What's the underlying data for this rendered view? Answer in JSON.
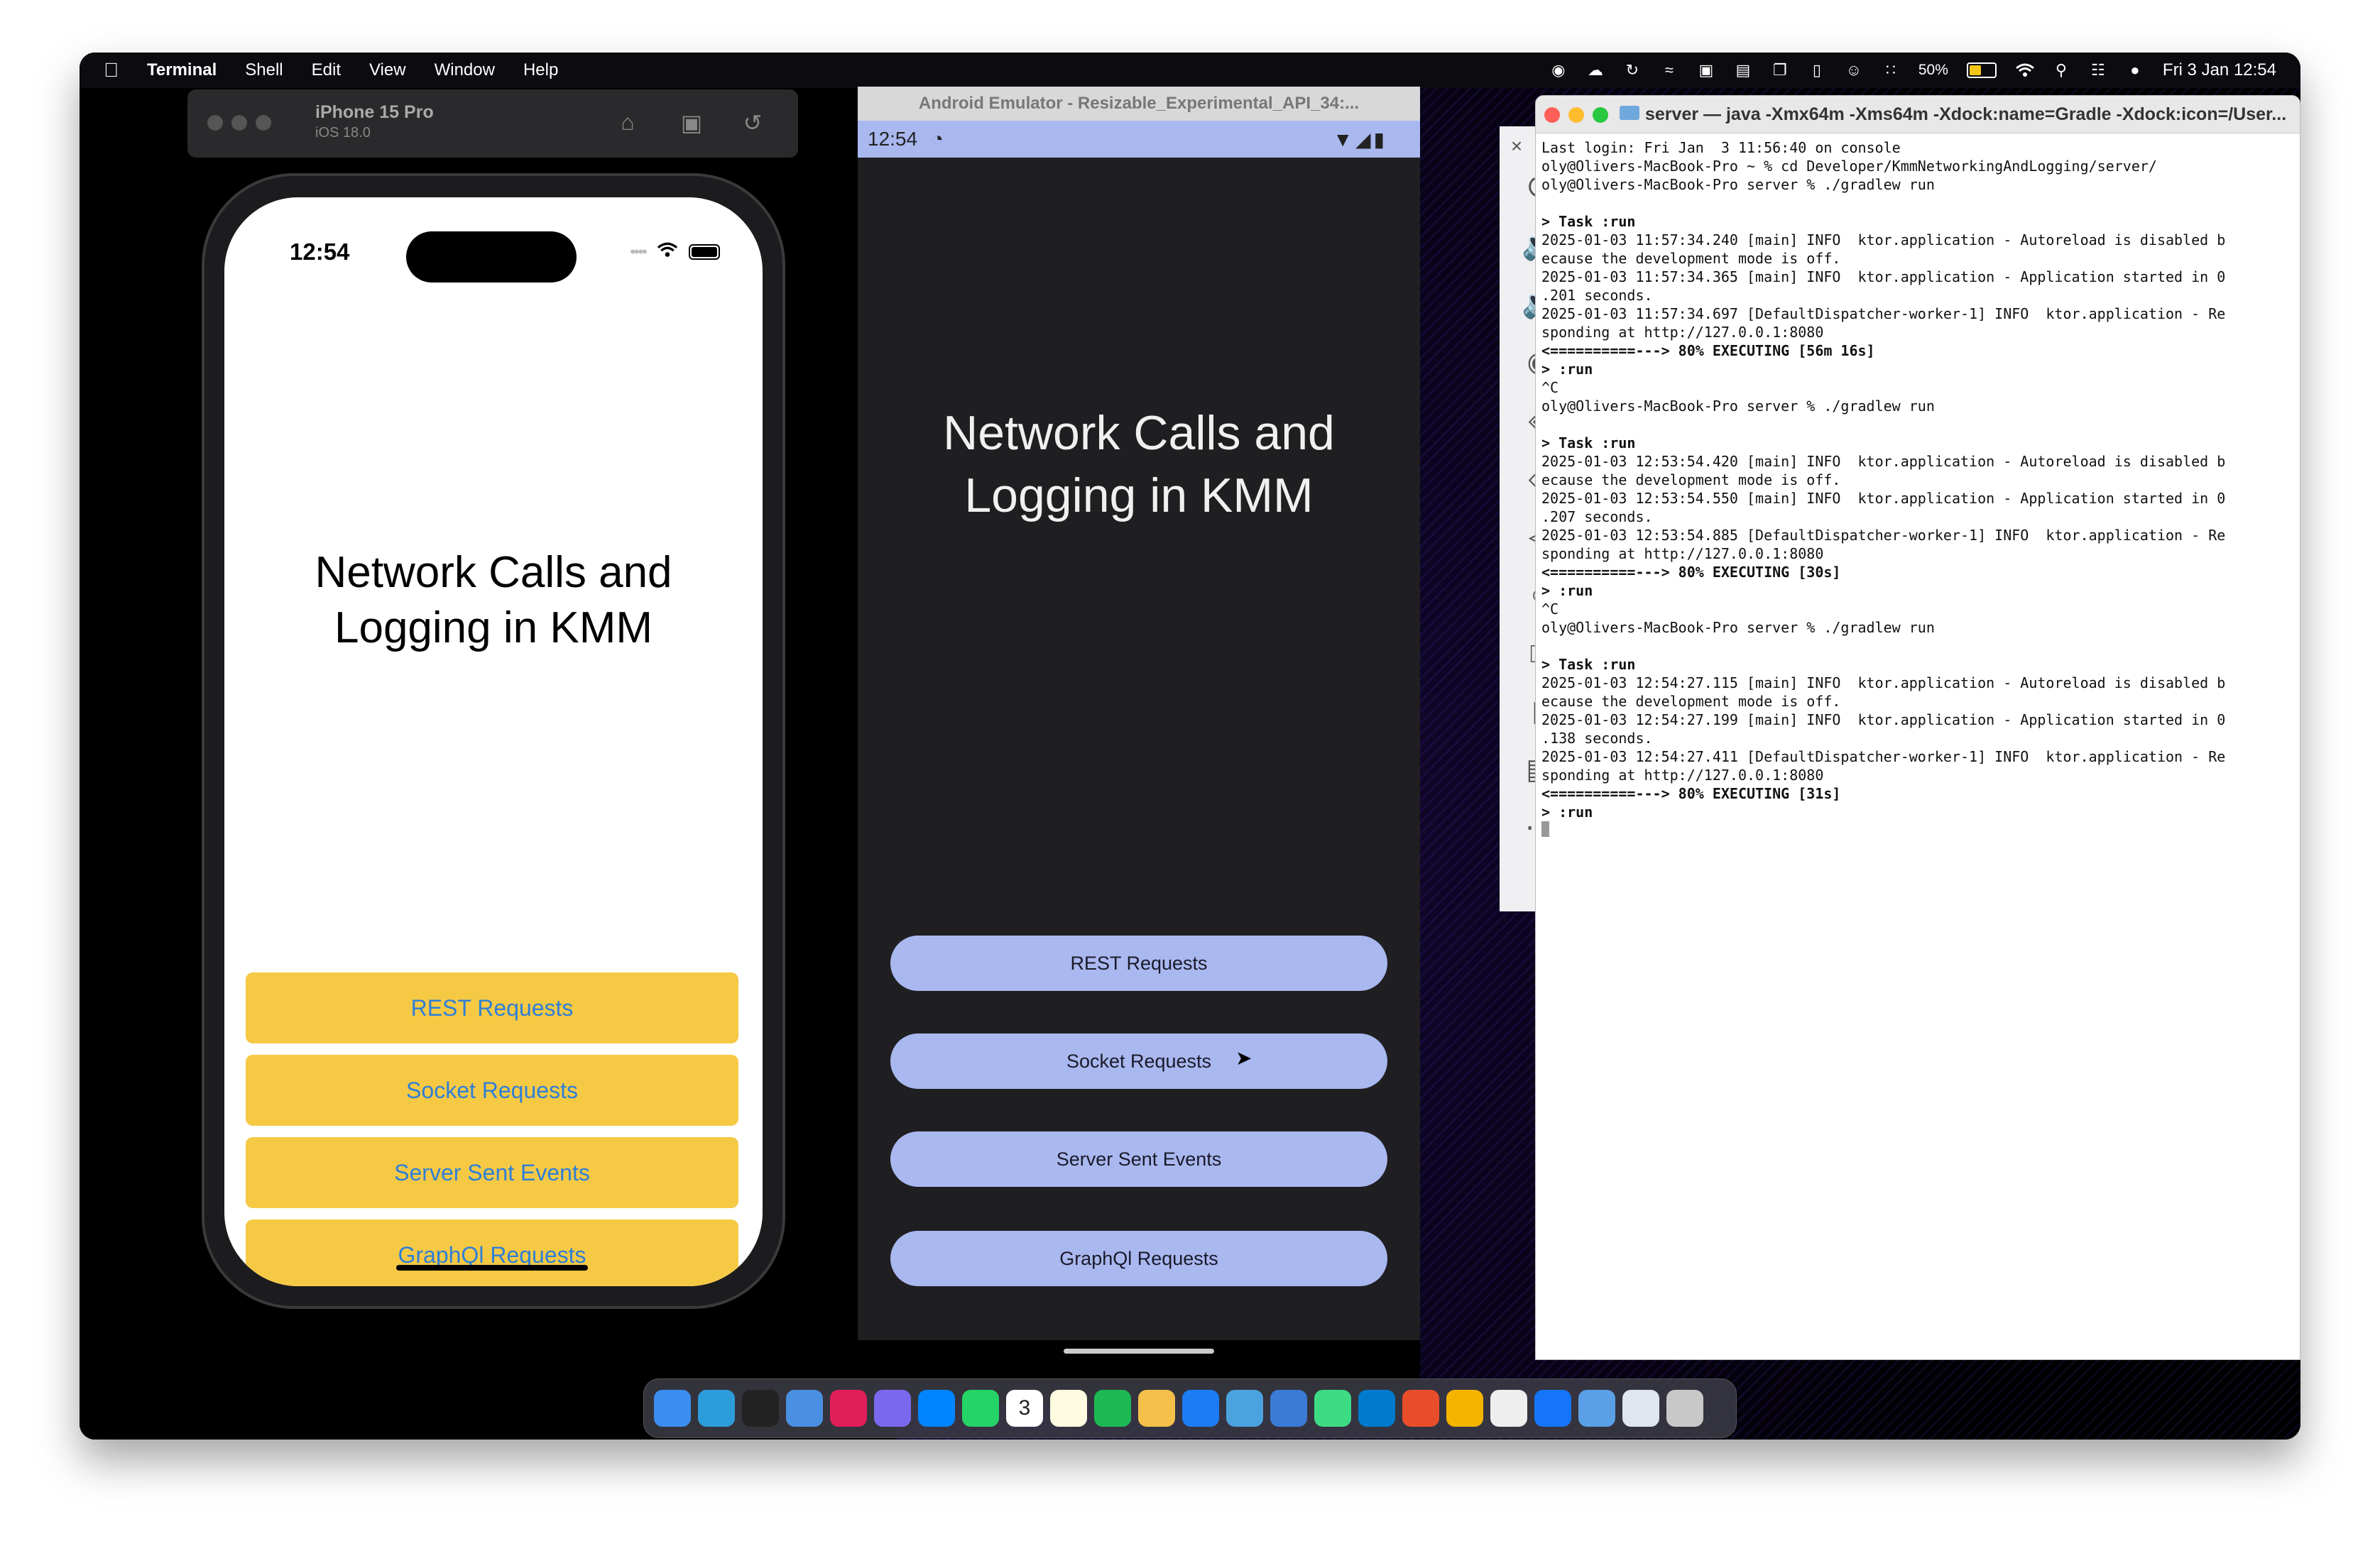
{
  "menubar": {
    "app_name": "Terminal",
    "items": [
      "Shell",
      "Edit",
      "View",
      "Window",
      "Help"
    ],
    "battery": "50%",
    "datetime": "Fri 3 Jan  12:54"
  },
  "simulator": {
    "device": "iPhone 15 Pro",
    "os": "iOS 18.0"
  },
  "iphone": {
    "time": "12:54",
    "title_line1": "Network Calls and",
    "title_line2": "Logging in KMM",
    "buttons": [
      "REST Requests",
      "Socket Requests",
      "Server Sent Events",
      "GraphQl Requests"
    ],
    "button_color": "#f6c945",
    "button_text_color": "#2e7fd6"
  },
  "android": {
    "window_title": "Android Emulator - Resizable_Experimental_API_34:...",
    "time": "12:54",
    "title_line1": "Network Calls and",
    "title_line2": "Logging in KMM",
    "buttons": [
      "REST Requests",
      "Socket Requests",
      "Server Sent Events",
      "GraphQl Requests"
    ],
    "button_color": "#aab8f0"
  },
  "terminal": {
    "title": "server — java -Xmx64m -Xms64m -Xdock:name=Gradle -Xdock:icon=/User...",
    "lines": [
      "Last login: Fri Jan  3 11:56:40 on console",
      "oly@Olivers-MacBook-Pro ~ % cd Developer/KmmNetworkingAndLogging/server/",
      "oly@Olivers-MacBook-Pro server % ./gradlew run",
      "",
      "> Task :run",
      "2025-01-03 11:57:34.240 [main] INFO  ktor.application - Autoreload is disabled b",
      "ecause the development mode is off.",
      "2025-01-03 11:57:34.365 [main] INFO  ktor.application - Application started in 0",
      ".201 seconds.",
      "2025-01-03 11:57:34.697 [DefaultDispatcher-worker-1] INFO  ktor.application - Re",
      "sponding at http://127.0.0.1:8080",
      "<==========---> 80% EXECUTING [56m 16s]",
      "> :run",
      "^C",
      "oly@Olivers-MacBook-Pro server % ./gradlew run",
      "",
      "> Task :run",
      "2025-01-03 12:53:54.420 [main] INFO  ktor.application - Autoreload is disabled b",
      "ecause the development mode is off.",
      "2025-01-03 12:53:54.550 [main] INFO  ktor.application - Application started in 0",
      ".207 seconds.",
      "2025-01-03 12:53:54.885 [DefaultDispatcher-worker-1] INFO  ktor.application - Re",
      "sponding at http://127.0.0.1:8080",
      "<==========---> 80% EXECUTING [30s]",
      "> :run",
      "^C",
      "oly@Olivers-MacBook-Pro server % ./gradlew run",
      "",
      "> Task :run",
      "2025-01-03 12:54:27.115 [main] INFO  ktor.application - Autoreload is disabled b",
      "ecause the development mode is off.",
      "2025-01-03 12:54:27.199 [main] INFO  ktor.application - Application started in 0",
      ".138 seconds.",
      "2025-01-03 12:54:27.411 [DefaultDispatcher-worker-1] INFO  ktor.application - Re",
      "sponding at http://127.0.0.1:8080",
      "<==========---> 80% EXECUTING [31s]",
      "> :run"
    ],
    "bold_line_indexes": [
      4,
      11,
      12,
      16,
      23,
      24,
      28,
      35,
      36
    ]
  },
  "dock": {
    "apps": [
      "finder-icon",
      "safari-icon",
      "terminal-icon",
      "mail-icon",
      "slack-icon",
      "clickup-icon",
      "messenger-icon",
      "whatsapp-icon",
      "calendar-icon",
      "notes-icon",
      "spotify-icon",
      "hand-icon",
      "appstore-icon",
      "preview-icon",
      "screen-sharing-icon",
      "android-studio-icon",
      "vscode-icon",
      "fig-icon",
      "chrome-icon",
      "textedit-icon",
      "xcode-icon",
      "folder-icon",
      "finder-window-icon",
      "trash-icon"
    ],
    "calendar_day": "3"
  }
}
